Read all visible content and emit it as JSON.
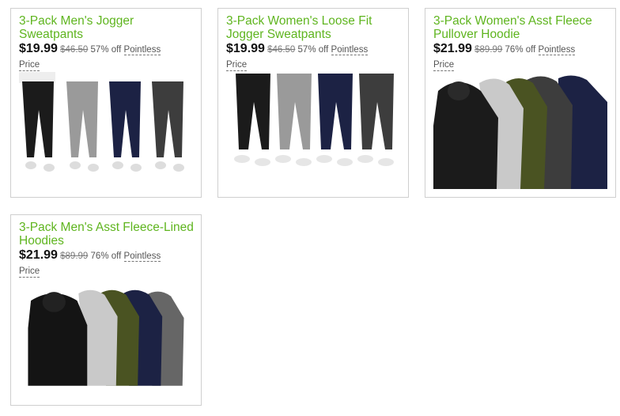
{
  "deals": [
    {
      "title": "3-Pack Men's Jogger Sweatpants",
      "price": "$19.99",
      "was": "$46.50",
      "off": "57% off",
      "pointless": "Pointless",
      "price_label": "Price",
      "image": "mens-jogger-sweatpants-image"
    },
    {
      "title": "3-Pack Women's Loose Fit Jogger Sweatpants",
      "price": "$19.99",
      "was": "$46.50",
      "off": "57% off",
      "pointless": "Pointless",
      "price_label": "Price",
      "image": "womens-jogger-sweatpants-image"
    },
    {
      "title": "3-Pack Women's Asst Fleece Pullover Hoodie",
      "price": "$21.99",
      "was": "$89.99",
      "off": "76% off",
      "pointless": "Pointless",
      "price_label": "Price",
      "image": "womens-fleece-hoodie-image"
    },
    {
      "title": "3-Pack Men's Asst Fleece-Lined Hoodies",
      "price": "$21.99",
      "was": "$89.99",
      "off": "76% off",
      "pointless": "Pointless",
      "price_label": "Price",
      "image": "mens-fleece-hoodies-image"
    }
  ],
  "colors": {
    "title_green": "#5fb51f",
    "border": "#cfcfcf",
    "black_item": "#1b1b1b",
    "gray_item": "#9a9a9a",
    "navy_item": "#1c2244",
    "charcoal_item": "#3d3d3d",
    "olive_item": "#4a5322"
  }
}
